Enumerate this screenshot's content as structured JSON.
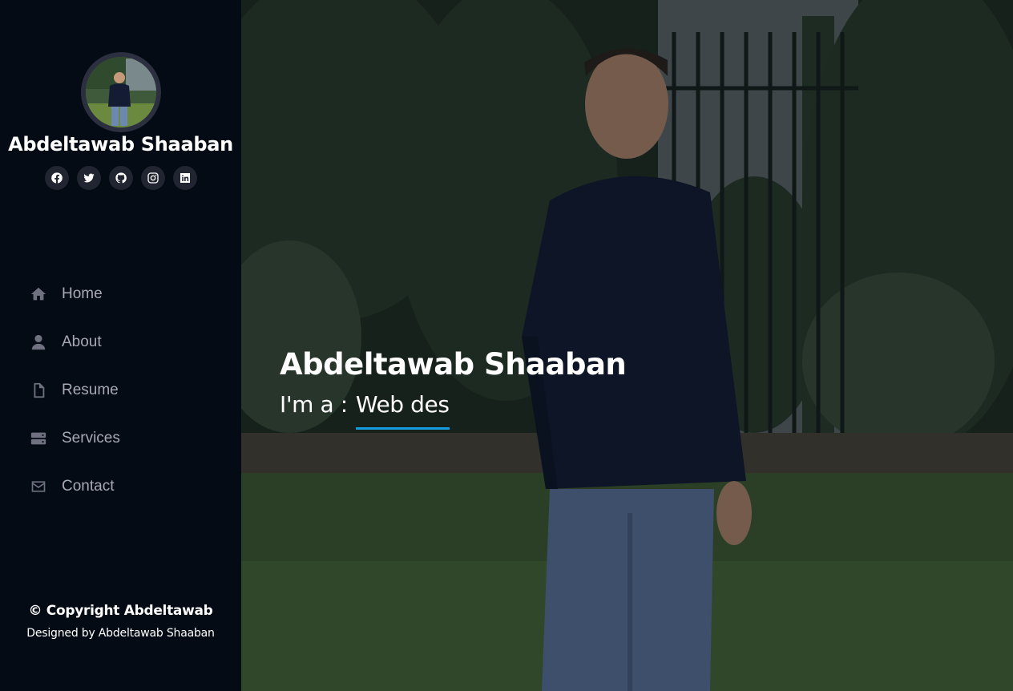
{
  "profile": {
    "name": "Abdeltawab Shaaban"
  },
  "socials": [
    {
      "icon": "facebook-icon"
    },
    {
      "icon": "twitter-icon"
    },
    {
      "icon": "github-icon"
    },
    {
      "icon": "instagram-icon"
    },
    {
      "icon": "linkedin-icon"
    }
  ],
  "nav": {
    "items": [
      {
        "label": "Home",
        "icon": "home-icon"
      },
      {
        "label": "About",
        "icon": "user-icon"
      },
      {
        "label": "Resume",
        "icon": "file-icon"
      },
      {
        "label": "Services",
        "icon": "server-icon"
      },
      {
        "label": "Contact",
        "icon": "envelope-icon"
      }
    ]
  },
  "footer": {
    "copyright": "© Copyright Abdeltawab",
    "designed": "Designed by Abdeltawab Shaaban"
  },
  "hero": {
    "name": "Abdeltawab Shaaban",
    "prefix": "I'm a :",
    "typed": "Web des"
  },
  "colors": {
    "sidebar_bg": "#040b14",
    "accent": "#149ddd",
    "nav_text": "#a8a9b4"
  }
}
